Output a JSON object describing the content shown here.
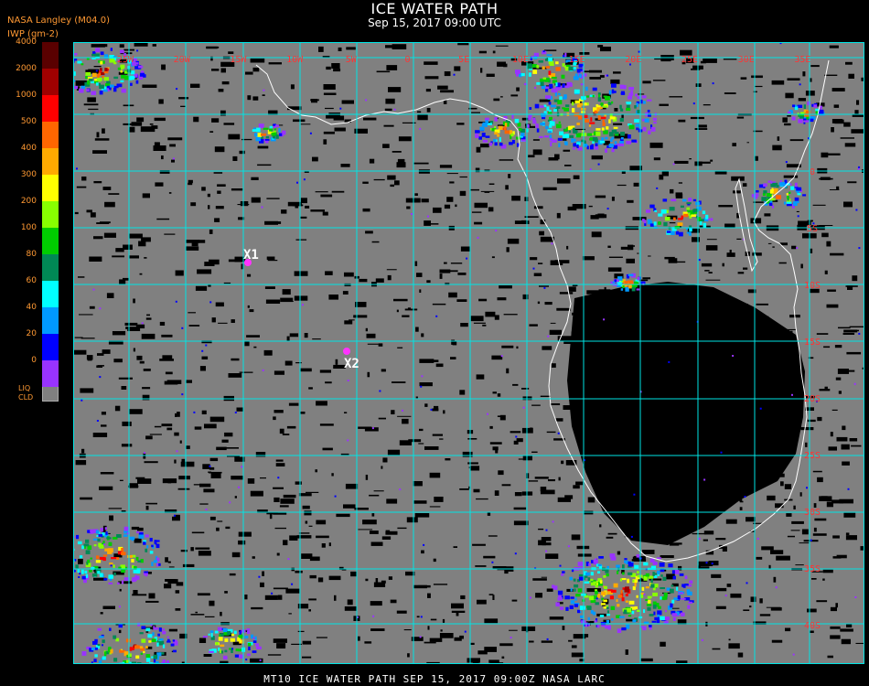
{
  "header": {
    "title": "ICE WATER PATH",
    "subtitle": "Sep 15, 2017 09:00 UTC",
    "source": "NASA Langley (M04.0)",
    "units": "IWP (gm-2)"
  },
  "legend": {
    "levels": [
      {
        "label": "4000",
        "color": "#5a0000"
      },
      {
        "label": "2000",
        "color": "#a00000"
      },
      {
        "label": "1000",
        "color": "#ff0000"
      },
      {
        "label": "500",
        "color": "#ff6600"
      },
      {
        "label": "400",
        "color": "#ffaa00"
      },
      {
        "label": "300",
        "color": "#ffff00"
      },
      {
        "label": "200",
        "color": "#88ff00"
      },
      {
        "label": "100",
        "color": "#00cc00"
      },
      {
        "label": "80",
        "color": "#008855"
      },
      {
        "label": "60",
        "color": "#00ffff"
      },
      {
        "label": "40",
        "color": "#0099ff"
      },
      {
        "label": "20",
        "color": "#0000ff"
      },
      {
        "label": "0",
        "color": "#9933ff"
      }
    ],
    "liquid_label_1": "LIQ",
    "liquid_label_2": "CLD",
    "liquid_color": "#808080"
  },
  "map": {
    "ocean_color": "#000000",
    "cloud_color": "#808080",
    "grid_color": "#00e5e5",
    "coast_color": "#ffffff",
    "lon_labels": [
      "25W",
      "20W",
      "15W",
      "10W",
      "5W",
      "0",
      "5E",
      "10E",
      "15E",
      "20E",
      "25E",
      "30E",
      "35E"
    ],
    "lat_labels": [
      "0",
      "5S",
      "10S",
      "15S",
      "20S",
      "25S",
      "30S",
      "35S",
      "40S"
    ],
    "markers": [
      {
        "label": "X1",
        "color": "#ff33ff"
      },
      {
        "label": "X2",
        "color": "#ff33ff"
      }
    ]
  },
  "footer": {
    "text": "MT10   ICE WATER PATH   SEP 15, 2017 09:00Z   NASA LARC"
  }
}
